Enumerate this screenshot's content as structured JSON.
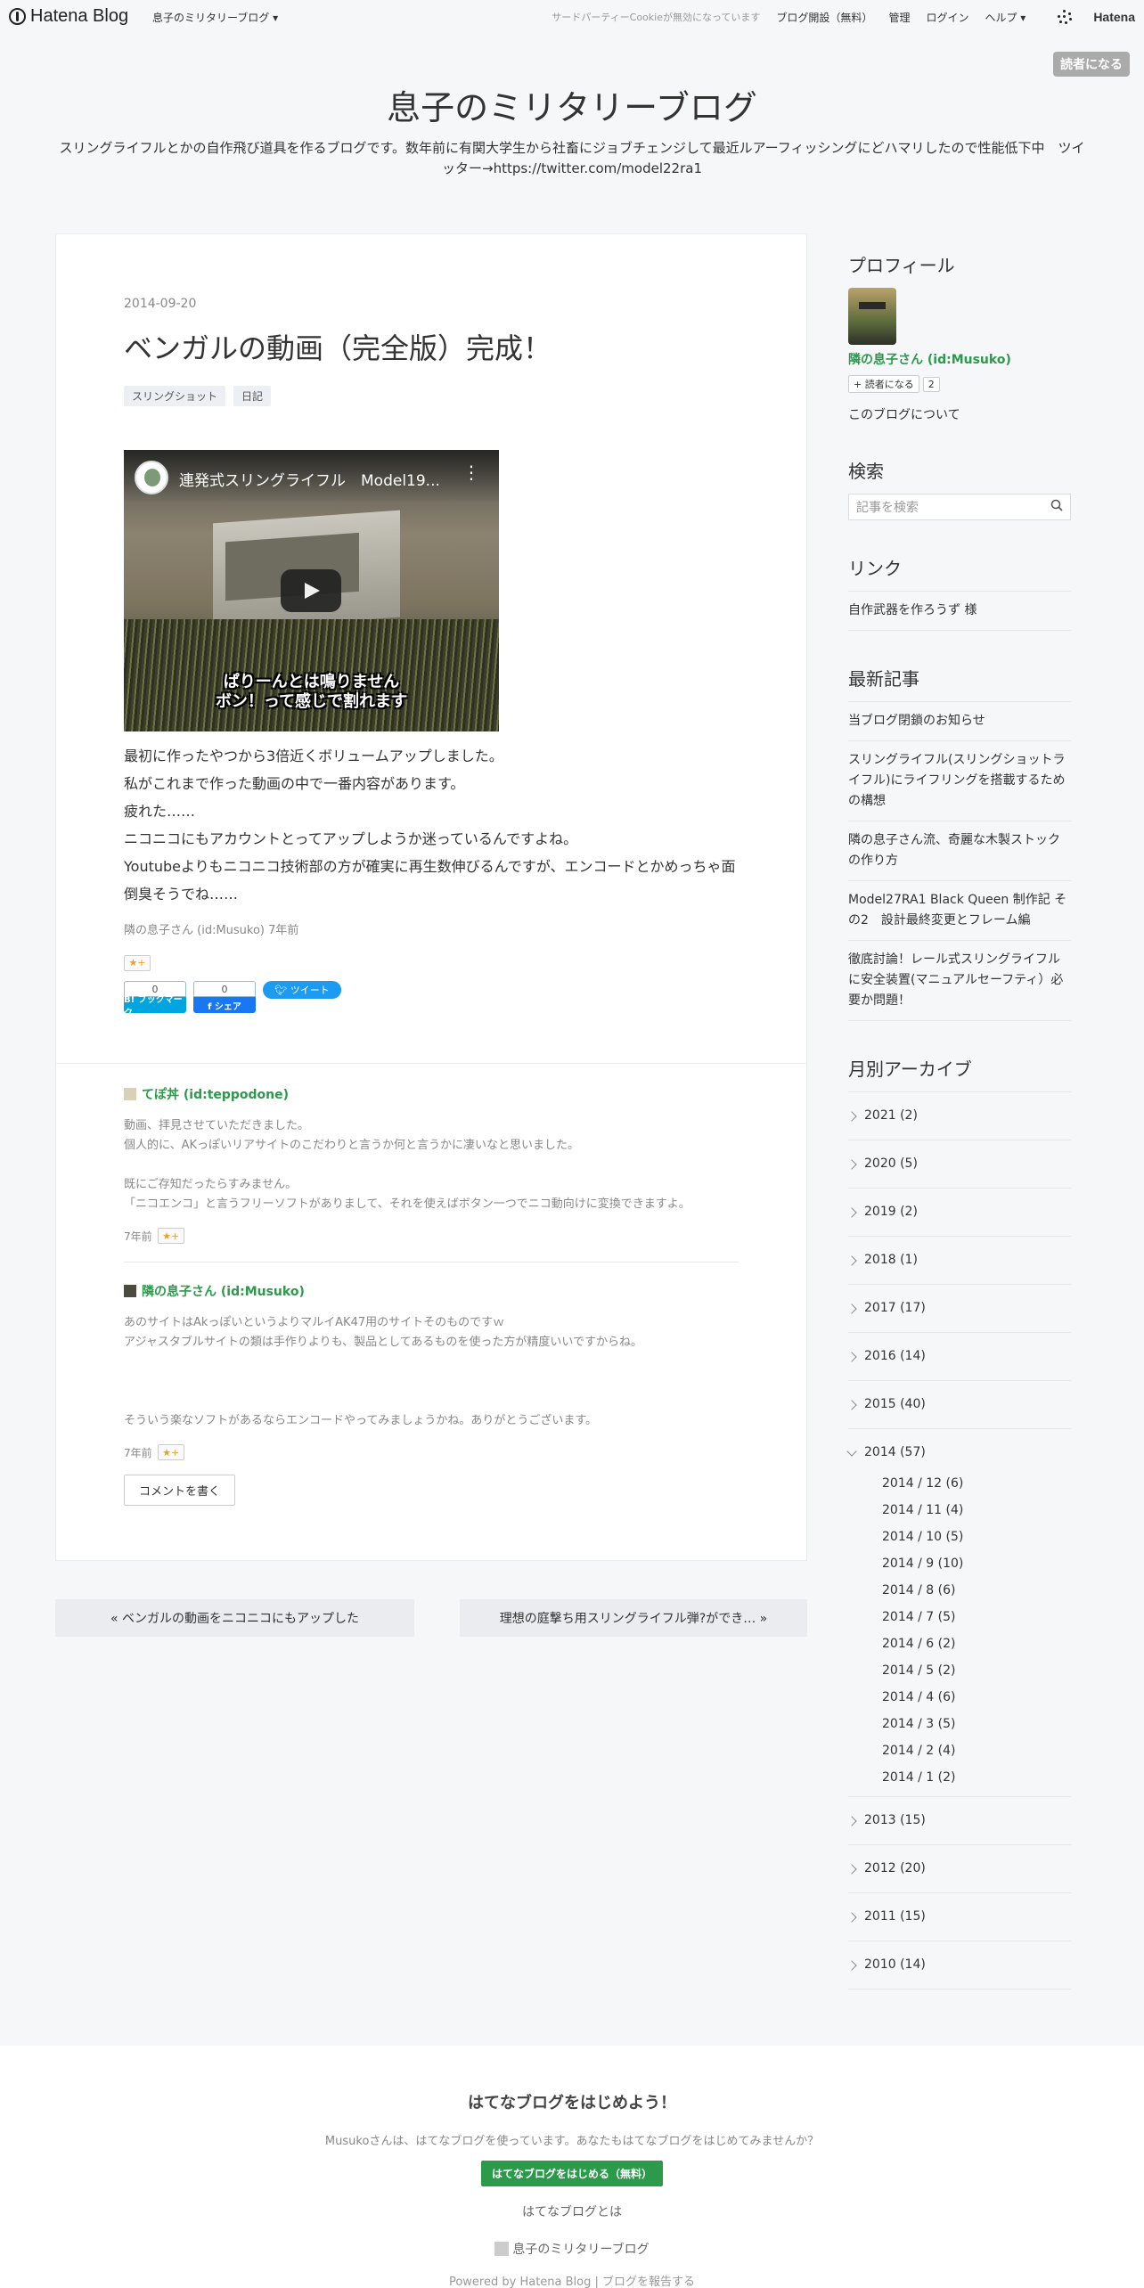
{
  "topbar": {
    "logo": "Hatena Blog",
    "blog_select": "息子のミリタリーブログ ▾",
    "cookie_notice": "サードパーティーCookieが無効になっています",
    "open_blog": "ブログ開設（無料）",
    "manage": "管理",
    "login": "ログイン",
    "help": "ヘルプ ▾",
    "hatena": "Hatena"
  },
  "subscribe_top": "読者になる",
  "site": {
    "title": "息子のミリタリーブログ",
    "description": "スリングライフルとかの自作飛び道具を作るブログです。数年前に有関大学生から社畜にジョブチェンジして最近ルアーフィッシングにどハマリしたので性能低下中　ツイッター→https://twitter.com/model22ra1"
  },
  "entry": {
    "date": "2014-09-20",
    "title": "ベンガルの動画（完全版）完成！",
    "categories": [
      "スリングショット",
      "日記"
    ],
    "video": {
      "title": "連発式スリングライフル　Model19...",
      "caption1": "ぱりーんとは鳴りません",
      "caption2": "ボン！って感じで割れます"
    },
    "lines": [
      "最初に作ったやつから3倍近くボリュームアップしました。",
      "私がこれまで作った動画の中で一番内容があります。",
      "疲れた……",
      "ニコニコにもアカウントとってアップしようか迷っているんですよね。",
      "Youtubeよりもニコニコ技術部の方が確実に再生数伸びるんですが、エンコードとかめっちゃ面倒臭そうでね……"
    ],
    "byline": "隣の息子さん (id:Musuko) 7年前",
    "star": "★+",
    "share": {
      "hatena_count": "0",
      "hatena_label": "B! ブックマーク",
      "fb_count": "0",
      "fb_label": "f シェア",
      "tweet": "ツイート"
    }
  },
  "comments": [
    {
      "author": "てぽ丼 (id:teppodone)",
      "lines": [
        "動画、拝見させていただきました。",
        "個人的に、AKっぽいリアサイトのこだわりと言うか何と言うかに凄いなと思いました。",
        "",
        "既にご存知だったらすみません。",
        "「ニコエンコ」と言うフリーソフトがありまして、それを使えばボタン一つでニコ動向けに変換できますよ。"
      ],
      "time": "7年前",
      "star": "★+"
    },
    {
      "author": "隣の息子さん (id:Musuko)",
      "lines": [
        "あのサイトはAkっぽいというよりマルイAK47用のサイトそのものですｗ",
        "アジャスタブルサイトの類は手作りよりも、製品としてあるものを使った方が精度いいですからね。",
        "",
        "",
        "",
        "そういう楽なソフトがあるならエンコードやってみましょうかね。ありがとうございます。"
      ],
      "time": "7年前",
      "star": "★+"
    }
  ],
  "write_comment": "コメントを書く",
  "pager": {
    "prev": "« ベンガルの動画をニコニコにもアップした",
    "next": "理想の庭撃ち用スリングライフル弾?ができ… »"
  },
  "sidebar": {
    "profile": {
      "heading": "プロフィール",
      "name": "隣の息子さん (id:Musuko)",
      "subscribe": "読者になる",
      "count": "2",
      "about": "このブログについて"
    },
    "search": {
      "heading": "検索",
      "placeholder": "記事を検索"
    },
    "links": {
      "heading": "リンク",
      "items": [
        "自作武器を作ろうず 様"
      ]
    },
    "recent": {
      "heading": "最新記事",
      "items": [
        "当ブログ閉鎖のお知らせ",
        "スリングライフル(スリングショットライフル)にライフリングを搭載するための構想",
        "隣の息子さん流、奇麗な木製ストックの作り方",
        "Model27RA1 Black Queen 制作記 その2　設計最終変更とフレーム編",
        "徹底討論！レール式スリングライフルに安全装置(マニュアルセーフティ）必要か問題！"
      ]
    },
    "archive": {
      "heading": "月別アーカイブ",
      "years_before": [
        "2021 (2)",
        "2020 (5)",
        "2019 (2)",
        "2018 (1)",
        "2017 (17)",
        "2016 (14)",
        "2015 (40)"
      ],
      "open_year": "2014 (57)",
      "months": [
        "2014 / 12 (6)",
        "2014 / 11 (4)",
        "2014 / 10 (5)",
        "2014 / 9 (10)",
        "2014 / 8 (6)",
        "2014 / 7 (5)",
        "2014 / 6 (2)",
        "2014 / 5 (2)",
        "2014 / 4 (6)",
        "2014 / 3 (5)",
        "2014 / 2 (4)",
        "2014 / 1 (2)"
      ],
      "years_after": [
        "2013 (15)",
        "2012 (20)",
        "2011 (15)",
        "2010 (14)"
      ]
    }
  },
  "footer": {
    "heading": "はてなブログをはじめよう！",
    "text": "Musukoさんは、はてなブログを使っています。あなたもはてなブログをはじめてみませんか？",
    "button": "はてなブログをはじめる（無料）",
    "about": "はてなブログとは",
    "blog_name": "息子のミリタリーブログ",
    "powered": "Powered by Hatena Blog | ブログを報告する"
  }
}
